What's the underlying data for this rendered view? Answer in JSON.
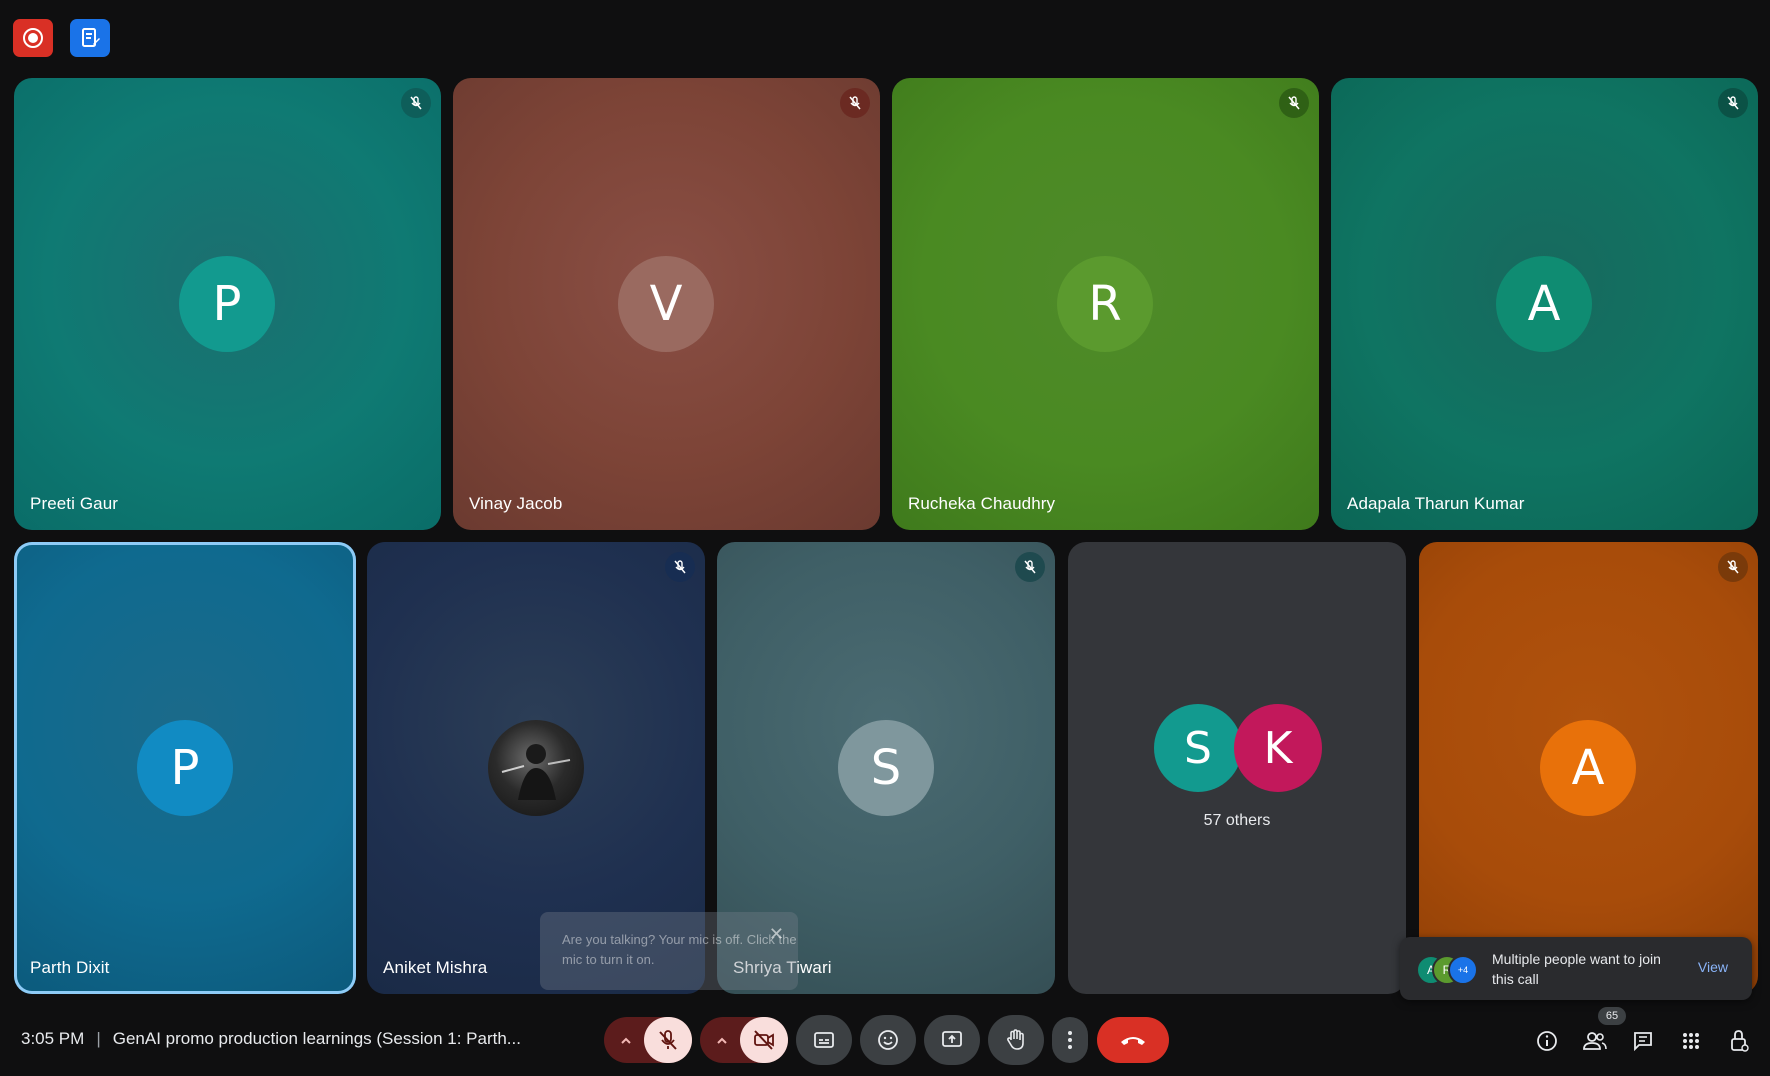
{
  "toolbar_top": {
    "record_icon": "record-icon",
    "notes_icon": "notes-icon"
  },
  "participants_row1": [
    {
      "name": "Preeti Gaur",
      "initial": "P",
      "avatar_color": "#129a8f",
      "muted": true
    },
    {
      "name": "Vinay Jacob",
      "initial": "V",
      "avatar_color": "#9a6a60",
      "muted": true
    },
    {
      "name": "Rucheka Chaudhry",
      "initial": "R",
      "avatar_color": "#5b9a2e",
      "muted": true
    },
    {
      "name": "Adapala Tharun Kumar",
      "initial": "A",
      "avatar_color": "#0f8c72",
      "muted": true
    }
  ],
  "participants_row2": [
    {
      "name": "Parth Dixit",
      "initial": "P",
      "avatar_color": "#118bc3",
      "muted": false,
      "active": true
    },
    {
      "name": "Aniket Mishra",
      "initial": "",
      "avatar_color": "#222222",
      "muted": true,
      "photo": true
    },
    {
      "name": "Shriya Tiwari",
      "initial": "S",
      "avatar_color": "#7f979d",
      "muted": true
    },
    {
      "name": "",
      "initial": "",
      "muted": false
    },
    {
      "name": "",
      "initial": "A",
      "avatar_color": "#e8710a",
      "muted": true
    }
  ],
  "others_tile": {
    "avatars": [
      {
        "initial": "S",
        "color": "#129a8f"
      },
      {
        "initial": "K",
        "color": "#c2185b"
      }
    ],
    "label": "57 others"
  },
  "mic_tooltip": {
    "text": "Are you talking? Your mic is off. Click the mic to turn it on."
  },
  "join_toast": {
    "avatars": [
      {
        "initial": "A",
        "color": "#0f8c72"
      },
      {
        "initial": "R",
        "color": "#5b9a2e"
      },
      {
        "initial": "+4",
        "color": "#1a73e8"
      }
    ],
    "message": "Multiple people want to join this call",
    "action": "View"
  },
  "meeting": {
    "time": "3:05 PM",
    "title": "GenAI promo production learnings (Session 1: Parth..."
  },
  "controls": {
    "mic_icon": "mic-off-icon",
    "camera_icon": "camera-off-icon",
    "captions_icon": "captions-icon",
    "emoji_icon": "emoji-icon",
    "present_icon": "present-icon",
    "raise_hand_icon": "raise-hand-icon",
    "more_icon": "more-options-icon",
    "end_call_icon": "end-call-icon"
  },
  "right_panel": {
    "people_count": "65"
  },
  "colors": {
    "accent": "#1a73e8",
    "danger": "#d93025",
    "active_border": "#8ecbf6"
  }
}
